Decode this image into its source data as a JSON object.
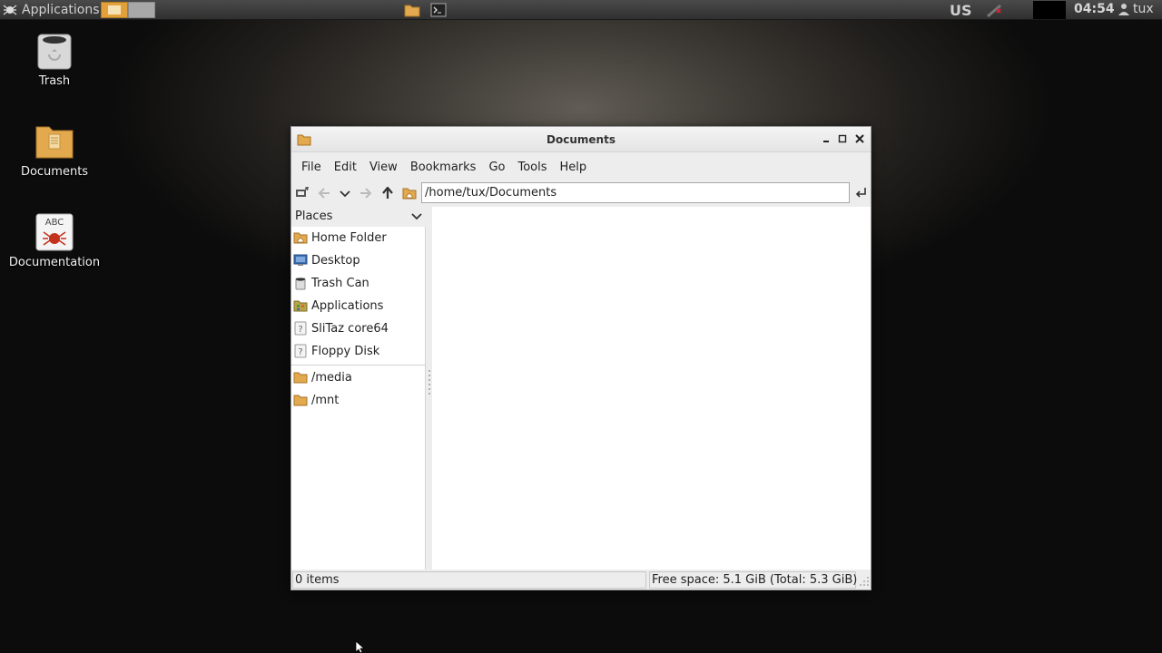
{
  "panel": {
    "applications_label": "Applications",
    "keyboard_layout": "US",
    "clock": "04:54",
    "user": "tux"
  },
  "desktop": {
    "icons": [
      {
        "label": "Trash"
      },
      {
        "label": "Documents"
      },
      {
        "label": "Documentation",
        "badge": "ABC"
      }
    ]
  },
  "window": {
    "title": "Documents",
    "menu": [
      "File",
      "Edit",
      "View",
      "Bookmarks",
      "Go",
      "Tools",
      "Help"
    ],
    "location": "/home/tux/Documents",
    "places_label": "Places",
    "places": [
      {
        "label": "Home Folder",
        "icon": "home-folder-icon"
      },
      {
        "label": "Desktop",
        "icon": "desktop-icon"
      },
      {
        "label": "Trash Can",
        "icon": "trash-icon"
      },
      {
        "label": "Applications",
        "icon": "applications-icon"
      },
      {
        "label": "SliTaz core64",
        "icon": "unknown-drive-icon"
      },
      {
        "label": "Floppy Disk",
        "icon": "unknown-drive-icon"
      }
    ],
    "bookmarks": [
      {
        "label": "/media",
        "icon": "folder-icon"
      },
      {
        "label": "/mnt",
        "icon": "folder-icon"
      }
    ],
    "status_items": "0 items",
    "status_space": "Free space: 5.1 GiB (Total: 5.3 GiB)"
  },
  "colors": {
    "folder": "#e2a94f",
    "workspace_active": "#e3a13c"
  }
}
